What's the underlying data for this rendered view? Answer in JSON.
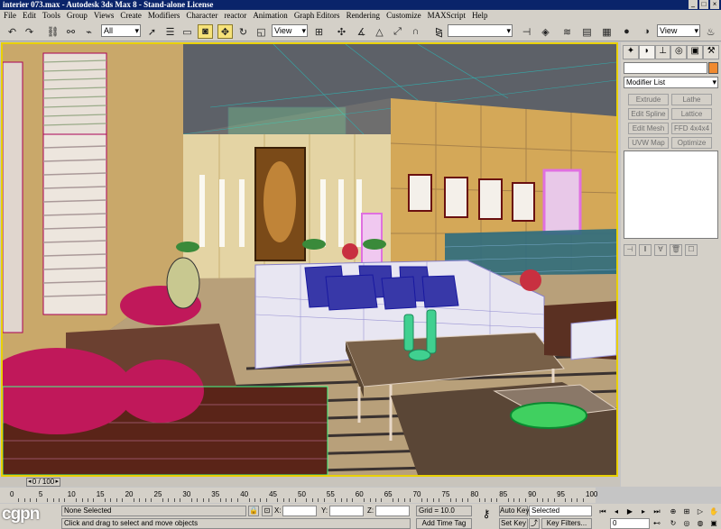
{
  "window": {
    "title": "interier 073.max - Autodesk 3ds Max 8 - Stand-alone License"
  },
  "menu": [
    "File",
    "Edit",
    "Tools",
    "Group",
    "Views",
    "Create",
    "Modifiers",
    "Character",
    "reactor",
    "Animation",
    "Graph Editors",
    "Rendering",
    "Customize",
    "MAXScript",
    "Help"
  ],
  "toolbar": {
    "selection_filter": "All",
    "ref_coord": "View",
    "named_selection": "",
    "render_view": "View",
    "icons": [
      "undo-icon",
      "redo-icon",
      "select-link-icon",
      "unlink-icon",
      "bind-spacewarp-icon",
      "select-object-icon",
      "select-by-name-icon",
      "rect-selection-icon",
      "window-crossing-icon",
      "select-move-icon",
      "select-rotate-icon",
      "select-scale-icon",
      "pivot-icon",
      "snap-toggle-icon",
      "angle-snap-icon",
      "percent-snap-icon",
      "spinner-snap-icon",
      "named-sel-edit-icon",
      "mirror-icon",
      "align-icon",
      "layer-manager-icon",
      "curve-editor-icon",
      "schematic-view-icon",
      "material-editor-icon",
      "render-scene-icon",
      "quick-render-icon"
    ]
  },
  "command_panel": {
    "tabs": [
      "create-tab-icon",
      "modify-tab-icon",
      "hierarchy-tab-icon",
      "motion-tab-icon",
      "display-tab-icon",
      "utilities-tab-icon"
    ],
    "name_value": "",
    "modifier_list": "Modifier List",
    "modifier_buttons": [
      "Extrude",
      "Lathe",
      "Edit Spline",
      "Lattice",
      "Edit Mesh",
      "FFD 4x4x4",
      "UVW Map",
      "Optimize"
    ],
    "accent": "#f08a30"
  },
  "time": {
    "frame_display": "0 / 100",
    "ticks": [
      "0",
      "5",
      "10",
      "15",
      "20",
      "25",
      "30",
      "35",
      "40",
      "45",
      "50",
      "55",
      "60",
      "65",
      "70",
      "75",
      "80",
      "85",
      "90",
      "95",
      "100"
    ]
  },
  "status": {
    "selection": "None Selected",
    "prompt": "Click and drag to select and move objects",
    "x_label": "X:",
    "y_label": "Y:",
    "z_label": "Z:",
    "grid": "Grid = 10.0",
    "add_time_tag": "Add Time Tag",
    "auto_key": "Auto Key",
    "set_key": "Set Key",
    "key_mode": "Selected",
    "key_filters": "Key Filters...",
    "current_frame": "0",
    "logo": "cgpn"
  }
}
